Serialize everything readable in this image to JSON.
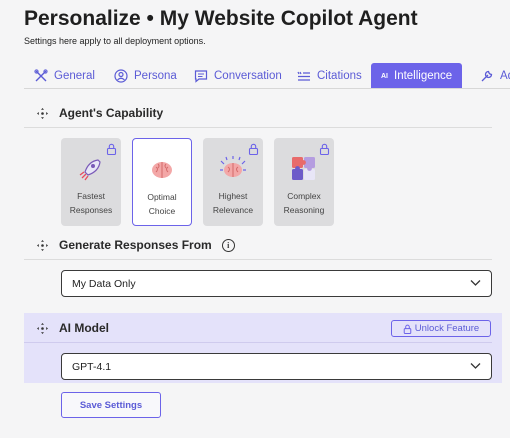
{
  "header": {
    "title": "Personalize • My Website Copilot Agent",
    "subtitle": "Settings here apply to all deployment options."
  },
  "tabs": [
    {
      "label": "General",
      "icon": "wrench-cross-icon",
      "active": false
    },
    {
      "label": "Persona",
      "icon": "user-circle-icon",
      "active": false
    },
    {
      "label": "Conversation",
      "icon": "chat-icon",
      "active": false
    },
    {
      "label": "Citations",
      "icon": "quote-list-icon",
      "active": false
    },
    {
      "label": "Intelligence",
      "icon": "ai-badge-icon",
      "badge": "AI",
      "active": true
    },
    {
      "label": "Ad",
      "icon": "tool-icon",
      "active": false
    }
  ],
  "capability": {
    "heading": "Agent's Capability",
    "cards": [
      {
        "line1": "Fastest",
        "line2": "Responses",
        "locked": true,
        "selected": false,
        "icon": "rocket-icon"
      },
      {
        "line1": "Optimal",
        "line2": "Choice",
        "locked": false,
        "selected": true,
        "icon": "brain-icon"
      },
      {
        "line1": "Highest",
        "line2": "Relevance",
        "locked": true,
        "selected": false,
        "icon": "brain-spark-icon"
      },
      {
        "line1": "Complex",
        "line2": "Reasoning",
        "locked": true,
        "selected": false,
        "icon": "puzzle-icon"
      }
    ]
  },
  "responses": {
    "heading": "Generate Responses From",
    "info": "i",
    "value": "My Data Only"
  },
  "ai_model": {
    "heading": "AI Model",
    "unlock_label": "Unlock Feature",
    "value": "GPT-4.1"
  },
  "actions": {
    "save_label": "Save Settings"
  },
  "colors": {
    "accent": "#6c63e9",
    "highlight": "#e4e2fa",
    "background": "#f5f5f6"
  }
}
